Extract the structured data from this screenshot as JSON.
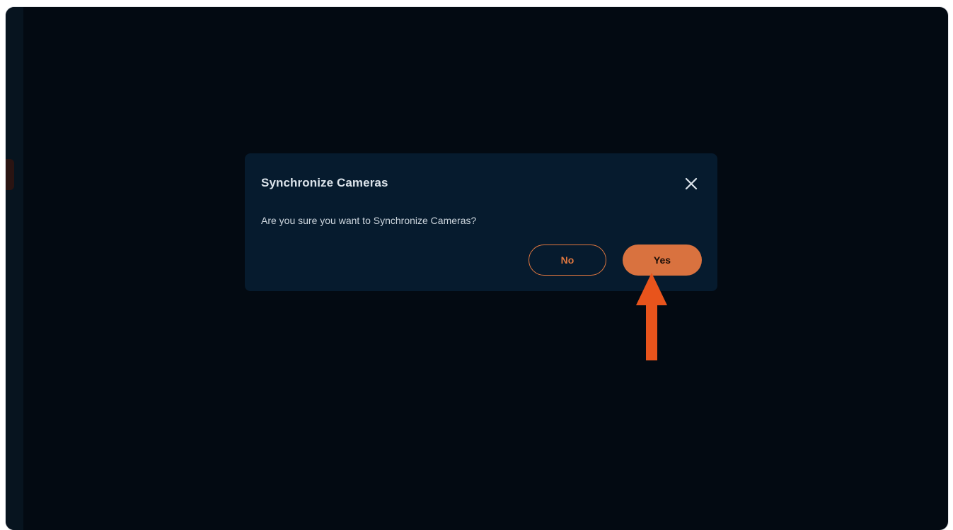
{
  "dialog": {
    "title": "Synchronize Cameras",
    "message": "Are you sure you want to Synchronize Cameras?",
    "no_label": "No",
    "yes_label": "Yes",
    "close_icon": "close-icon"
  },
  "annotation": {
    "arrow_icon": "arrow-up-icon"
  },
  "colors": {
    "background": "#030a12",
    "dialog_bg": "#061b2e",
    "accent": "#d9723f",
    "annotation_arrow": "#e8541c"
  }
}
